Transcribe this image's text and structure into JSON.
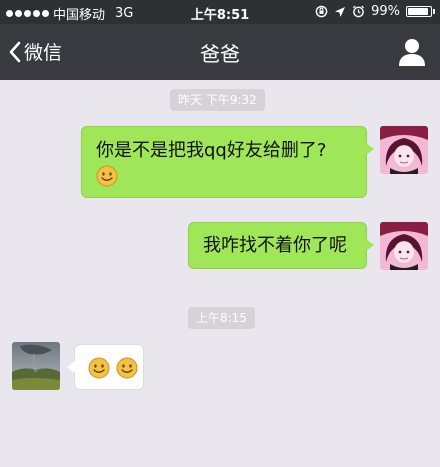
{
  "status_bar": {
    "carrier": "中国移动",
    "network": "3G",
    "time": "上午8:51",
    "battery_text": "99%",
    "battery_level": 0.99,
    "signal_strength": 5,
    "icons": [
      "orientation-lock-icon",
      "location-icon",
      "alarm-icon"
    ]
  },
  "nav": {
    "back_label": "微信",
    "title": "爸爸",
    "back_icon": "chevron-left-icon",
    "profile_icon": "person-icon"
  },
  "messages": [
    {
      "type": "timestamp",
      "text": "昨天 下午9:32"
    },
    {
      "type": "outgoing",
      "text": "你是不是把我qq好友给删了?",
      "emoji": [
        "smile"
      ]
    },
    {
      "type": "outgoing",
      "text": "我咋找不着你了呢"
    },
    {
      "type": "timestamp",
      "text": "上午8:15"
    },
    {
      "type": "incoming",
      "emoji": [
        "smile",
        "smile"
      ]
    }
  ],
  "colors": {
    "status_bar": "#2e3033",
    "nav_bar": "#393a3f",
    "chat_background": "#e9e6ed",
    "outgoing_bubble": "#9fe658",
    "incoming_bubble": "#ffffff",
    "timestamp_pill": "#d5d3d8"
  }
}
